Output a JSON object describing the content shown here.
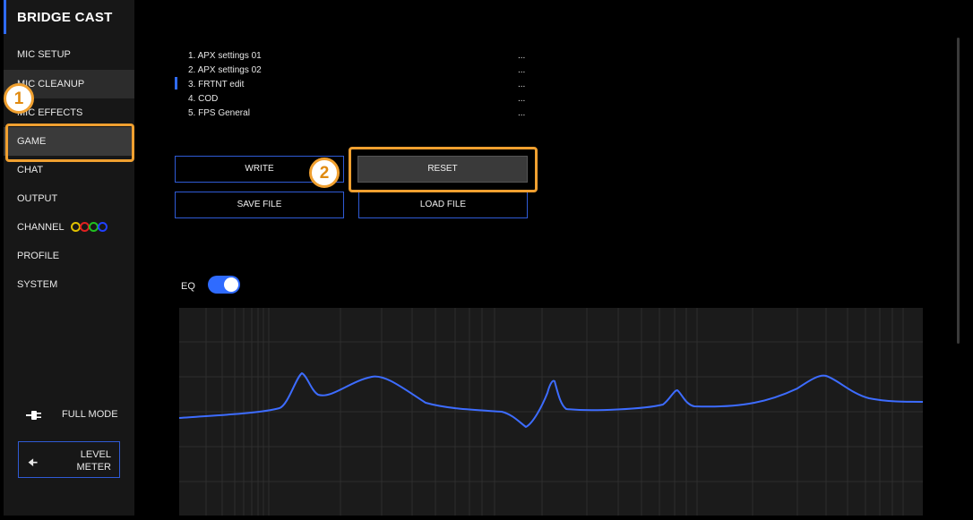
{
  "app": {
    "title": "BRIDGE CAST"
  },
  "sidebar": {
    "items": [
      {
        "label": "MIC SETUP"
      },
      {
        "label": "MIC CLEANUP"
      },
      {
        "label": "MIC EFFECTS"
      },
      {
        "label": "GAME",
        "selected": true
      },
      {
        "label": "CHAT"
      },
      {
        "label": "OUTPUT"
      },
      {
        "label": "CHANNEL"
      },
      {
        "label": "PROFILE"
      },
      {
        "label": "SYSTEM"
      }
    ],
    "channel_colors": [
      "#e0c000",
      "#e02020",
      "#20c020",
      "#2040ff"
    ],
    "full_mode_label": "FULL MODE",
    "level_meter_line1": "LEVEL",
    "level_meter_line2": "METER"
  },
  "presets": [
    {
      "label": "1. APX settings 01",
      "more": "..."
    },
    {
      "label": "2. APX settings 02",
      "more": "..."
    },
    {
      "label": "3. FRTNT edit",
      "more": "...",
      "selected": true
    },
    {
      "label": "4. COD",
      "more": "..."
    },
    {
      "label": "5. FPS General",
      "more": "..."
    }
  ],
  "buttons": {
    "write": "WRITE",
    "reset": "RESET",
    "save_file": "SAVE FILE",
    "load_file": "LOAD FILE"
  },
  "eq": {
    "label": "EQ",
    "enabled": true
  },
  "callouts": {
    "one": "1",
    "two": "2"
  },
  "colors": {
    "accent": "#2f6bff",
    "callout": "#f0a030"
  }
}
